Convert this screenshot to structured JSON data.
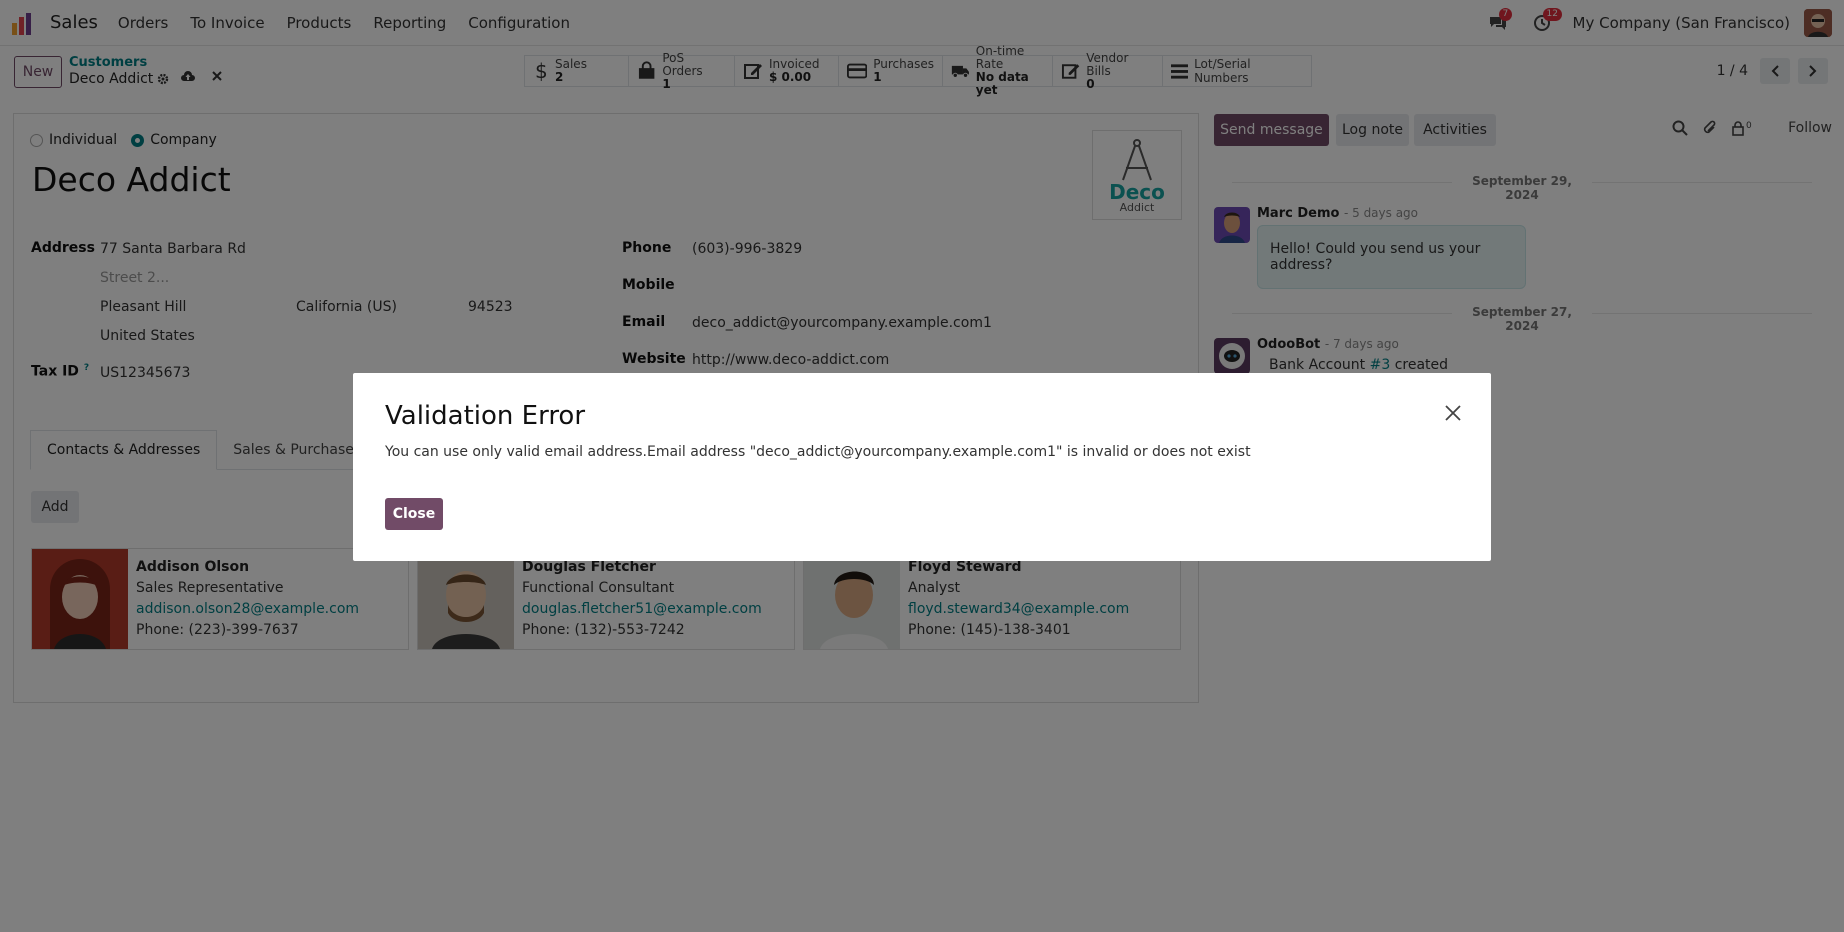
{
  "navbar": {
    "app_name": "Sales",
    "menu": [
      "Orders",
      "To Invoice",
      "Products",
      "Reporting",
      "Configuration"
    ],
    "messages_count": "7",
    "activities_count": "12",
    "company": "My Company (San Francisco)"
  },
  "control_panel": {
    "new_label": "New",
    "breadcrumb_parent": "Customers",
    "breadcrumb_current": "Deco Addict",
    "smart_buttons": [
      {
        "label": "Sales",
        "value": "2",
        "icon": "dollar-icon"
      },
      {
        "label": "PoS Orders",
        "value": "1",
        "icon": "shopping-bag-icon"
      },
      {
        "label": "Invoiced",
        "value": "$ 0.00",
        "icon": "pencil-square-icon"
      },
      {
        "label": "Purchases",
        "value": "1",
        "icon": "credit-card-icon"
      },
      {
        "label": "On-time Rate",
        "value": "No data yet",
        "icon": "truck-icon"
      },
      {
        "label": "Vendor Bills",
        "value": "0",
        "icon": "pencil-square-icon"
      },
      {
        "label": "Lot/Serial Numbers",
        "value": "",
        "icon": "list-icon"
      }
    ],
    "pager": "1 / 4"
  },
  "form": {
    "type_individual": "Individual",
    "type_company": "Company",
    "name": "Deco Addict",
    "logo_line1": "Deco",
    "logo_line2": "Addict",
    "address_label": "Address",
    "street": "77 Santa Barbara Rd",
    "street2_placeholder": "Street 2...",
    "city": "Pleasant Hill",
    "state": "California (US)",
    "zip": "94523",
    "country": "United States",
    "tax_id_label": "Tax ID",
    "tax_id_help": "?",
    "tax_id": "US12345673",
    "phone_label": "Phone",
    "phone": "(603)-996-3829",
    "mobile_label": "Mobile",
    "email_label": "Email",
    "email": "deco_addict@yourcompany.example.com1",
    "website_label": "Website",
    "website": "http://www.deco-addict.com",
    "tabs": [
      "Contacts & Addresses",
      "Sales & Purchase"
    ],
    "add_label": "Add",
    "contacts": [
      {
        "name": "Addison Olson",
        "role": "Sales Representative",
        "email": "addison.olson28@example.com",
        "phone": "Phone: (223)-399-7637"
      },
      {
        "name": "Douglas Fletcher",
        "role": "Functional Consultant",
        "email": "douglas.fletcher51@example.com",
        "phone": "Phone: (132)-553-7242"
      },
      {
        "name": "Floyd Steward",
        "role": "Analyst",
        "email": "floyd.steward34@example.com",
        "phone": "Phone: (145)-138-3401"
      }
    ]
  },
  "chatter": {
    "send_message": "Send message",
    "log_note": "Log note",
    "activities": "Activities",
    "followers_count": "0",
    "follow": "Follow",
    "date1": "September 29, 2024",
    "msg1_author": "Marc Demo",
    "msg1_time": "- 5 days ago",
    "msg1_body": "Hello! Could you send us your address?",
    "date2": "September 27, 2024",
    "msg2_author": "OdooBot",
    "msg2_time": "- 7 days ago",
    "msg2_body_pre": "Bank Account",
    "msg2_body_link": "#3",
    "msg2_body_post": "created"
  },
  "dialog": {
    "title": "Validation Error",
    "message": "You can use only valid email address.Email address \"deco_addict@yourcompany.example.com1\" is invalid or does not exist",
    "close_label": "Close"
  },
  "colors": {
    "primary": "#714b67",
    "accent": "#017e84",
    "badge": "#e02d3c"
  }
}
